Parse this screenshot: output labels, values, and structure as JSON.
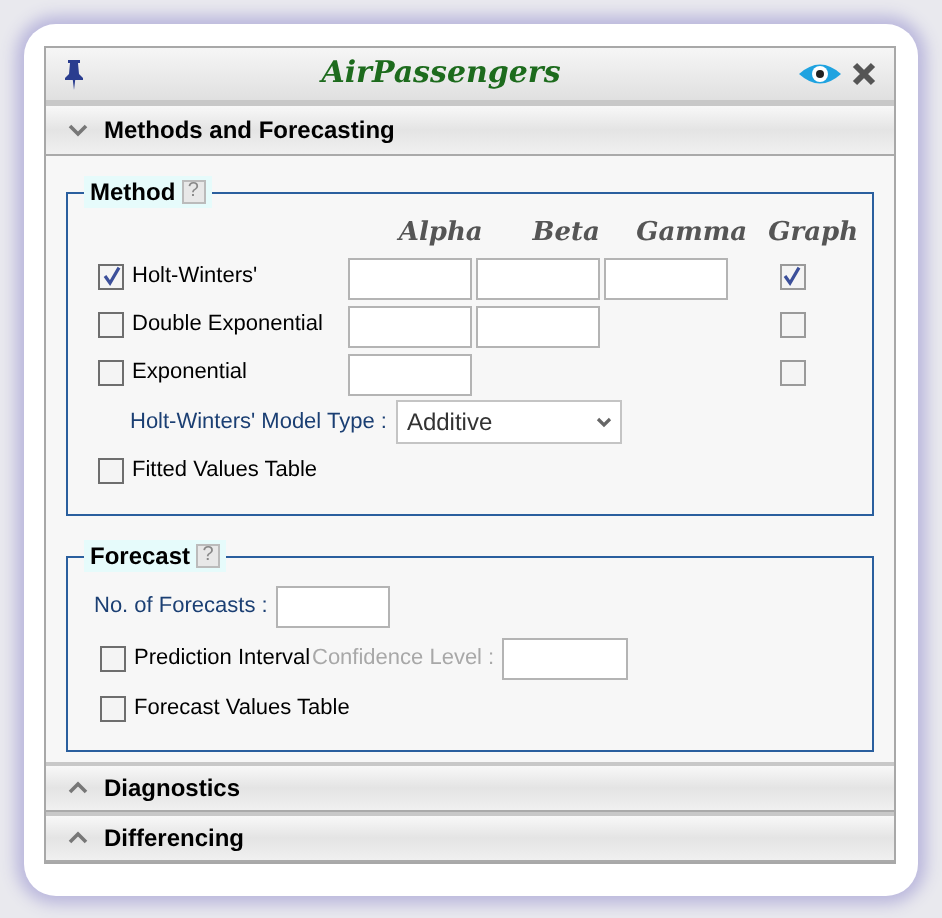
{
  "window": {
    "title": "AirPassengers"
  },
  "sections": [
    {
      "title": "Methods and Forecasting",
      "expanded": true
    },
    {
      "title": "Diagnostics",
      "expanded": false
    },
    {
      "title": "Differencing",
      "expanded": false
    }
  ],
  "method": {
    "legend": "Method",
    "help": "?",
    "columns": [
      "Alpha",
      "Beta",
      "Gamma",
      "Graph"
    ],
    "rows": [
      {
        "label": "Holt-Winters'",
        "checked": true,
        "alpha_field": true,
        "beta_field": true,
        "gamma_field": true,
        "graph_checked": true
      },
      {
        "label": "Double Exponential",
        "checked": false,
        "alpha_field": true,
        "beta_field": true,
        "gamma_field": false,
        "graph_checked": false
      },
      {
        "label": "Exponential",
        "checked": false,
        "alpha_field": true,
        "beta_field": false,
        "gamma_field": false,
        "graph_checked": false
      }
    ],
    "model_type": {
      "label": "Holt-Winters' Model Type :",
      "value": "Additive"
    },
    "fitted_table": {
      "label": "Fitted Values Table",
      "checked": false
    }
  },
  "forecast": {
    "legend": "Forecast",
    "help": "?",
    "count_label": "No. of Forecasts :",
    "prediction": {
      "label": "Prediction Interval",
      "checked": false
    },
    "confidence": {
      "label": "Confidence Level :",
      "disabled": true
    },
    "values_table": {
      "label": "Forecast Values Table",
      "checked": false
    }
  }
}
